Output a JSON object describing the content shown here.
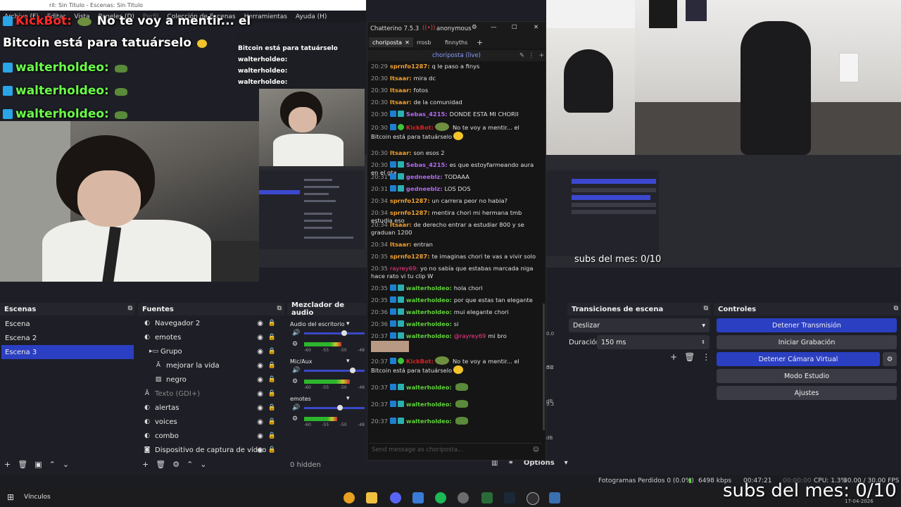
{
  "obs": {
    "window_title": "ril: Sin Titulo - Escenas: Sin Titulo",
    "menu": [
      "Archivo (F)",
      "Editar",
      "Vista",
      "Paneles (D)",
      "Perfil",
      "Colección de Escenas",
      "Herramientas",
      "Ayuda (H)"
    ],
    "scenes": {
      "title": "Escenas",
      "items": [
        "Escena",
        "Escena 2",
        "Escena 3"
      ],
      "selected": 2
    },
    "sources": {
      "title": "Fuentes",
      "items": [
        {
          "label": "Navegador 2",
          "icon": "browser-icon",
          "indent": 0
        },
        {
          "label": "emotes",
          "icon": "browser-icon",
          "indent": 0
        },
        {
          "label": "Grupo",
          "icon": "folder-icon",
          "indent": 1
        },
        {
          "label": "mejorar la vida",
          "icon": "text-icon",
          "indent": 2
        },
        {
          "label": "negro",
          "icon": "image-icon",
          "indent": 2
        },
        {
          "label": "Texto (GDI+)",
          "icon": "text-icon",
          "indent": 0,
          "dim": true
        },
        {
          "label": "alertas",
          "icon": "browser-icon",
          "indent": 0
        },
        {
          "label": "voices",
          "icon": "browser-icon",
          "indent": 0
        },
        {
          "label": "combo",
          "icon": "browser-icon",
          "indent": 0
        },
        {
          "label": "Dispositivo de captura de vídeo",
          "icon": "camera-icon",
          "indent": 0
        }
      ]
    },
    "mixer": {
      "title": "Mezclador de audio",
      "channels": [
        {
          "name": "Audio del escritorio",
          "level": 0.62
        },
        {
          "name": "Mic/Aux",
          "level": 0.75
        },
        {
          "name": "emotes",
          "level": 0.55
        }
      ],
      "ticks": [
        "-60",
        "-55",
        "-50",
        "-48"
      ],
      "right_db": [
        "0.0 dB",
        "5.2 dB",
        "9.3 dB"
      ],
      "hidden": "0 hidden",
      "options": "Options"
    },
    "transitions": {
      "title": "Transiciones de escena",
      "type": "Deslizar",
      "duration_label": "Duración",
      "duration_value": "150 ms"
    },
    "controls": {
      "title": "Controles",
      "buttons": [
        "Detener Transmisión",
        "Iniciar Grabación",
        "Detener Cámara Virtual",
        "Modo Estudio",
        "Ajustes"
      ]
    },
    "status": {
      "dropped": "Fotogramas Perdidos 0 (0.0%)",
      "bitrate": "6498 kbps",
      "live_time": "00:47:21",
      "rec_time": "00:00:00",
      "cpu": "CPU: 1.3%",
      "fps": "30.00 / 30.00 FPS"
    }
  },
  "overlay": {
    "lines": [
      {
        "user": "KickBot:",
        "text": "No te voy a mentir... el"
      },
      {
        "text": "Bitcoin está para tatuárselo"
      },
      {
        "user": "walterholdeo:"
      },
      {
        "user": "walterholdeo:"
      },
      {
        "user": "walterholdeo:"
      }
    ],
    "mini_lines": [
      "Bitcoin está para tatuárselo",
      "walterholdeo:",
      "walterholdeo:",
      "walterholdeo:"
    ],
    "subs_small": "subs del mes: 0/10",
    "subs_big": "subs del mes: 0/10"
  },
  "chatterino": {
    "title": "Chatterino 7.5.3",
    "account": "anonymous",
    "tabs": [
      "choriposta",
      "rrosb",
      "finnyths"
    ],
    "active_tab": 0,
    "channel": "choriposta (live)",
    "input_placeholder": "Send message as choriposta...",
    "messages": [
      {
        "time": "20:29",
        "user": "sprnfo1287:",
        "color": "orange",
        "text": "q le paso a finys"
      },
      {
        "time": "20:30",
        "user": "Itsaar:",
        "color": "orange",
        "text": "mira dc"
      },
      {
        "time": "20:30",
        "user": "Itsaar:",
        "color": "orange",
        "text": "fotos"
      },
      {
        "time": "20:30",
        "user": "Itsaar:",
        "color": "orange",
        "text": "de la comunidad"
      },
      {
        "time": "20:30",
        "user": "Sebas_4215:",
        "color": "purple",
        "text": "DONDE ESTA MI CHORII"
      },
      {
        "time": "20:30",
        "user": "KickBot:",
        "color": "red",
        "text": "No te voy a mentir... el Bitcoin está para tatuárselo"
      },
      {
        "time": "20:30",
        "user": "Itsaar:",
        "color": "orange",
        "text": "son esos 2"
      },
      {
        "time": "20:30",
        "user": "Sebas_4215:",
        "color": "purple",
        "text": "es que estoyfarmeando aura en el gta"
      },
      {
        "time": "20:31",
        "user": "gedneeblz:",
        "color": "purple",
        "text": "TODAAA"
      },
      {
        "time": "20:31",
        "user": "gedneeblz:",
        "color": "purple",
        "text": "LOS DOS"
      },
      {
        "time": "20:34",
        "user": "sprnfo1287:",
        "color": "orange",
        "text": "un carrera peor no habia?"
      },
      {
        "time": "20:34",
        "user": "sprnfo1287:",
        "color": "orange",
        "text": "mentira chori mi hermana tmb estudia eso"
      },
      {
        "time": "20:34",
        "user": "Itsaar:",
        "color": "orange",
        "text": "de derecho entrar a estudiar 800 y se graduan 1200"
      },
      {
        "time": "20:34",
        "user": "Itsaar:",
        "color": "orange",
        "text": "entran"
      },
      {
        "time": "20:35",
        "user": "sprnfo1287:",
        "color": "orange",
        "text": "te imaginas chori te vas a vivir solo"
      },
      {
        "time": "20:35",
        "user": "rayrey69:",
        "color": "pink",
        "text": "yo no sabía que estabas marcada niga hace rato vi tu clip W"
      },
      {
        "time": "20:35",
        "user": "walterholdeo:",
        "color": "green",
        "text": "hola chori"
      },
      {
        "time": "20:35",
        "user": "walterholdeo:",
        "color": "green",
        "text": "por que estas tan elegante"
      },
      {
        "time": "20:36",
        "user": "walterholdeo:",
        "color": "green",
        "text": "mui elegante chori"
      },
      {
        "time": "20:36",
        "user": "walterholdeo:",
        "color": "green",
        "text": "si"
      },
      {
        "time": "20:37",
        "user": "walterholdeo:",
        "color": "green",
        "text": "mi bro",
        "mention": "@rayrey69"
      },
      {
        "time": "20:37",
        "user": "KickBot:",
        "color": "red",
        "text": "No te voy a mentir... el Bitcoin está para tatuárselo"
      },
      {
        "time": "20:37",
        "user": "walterholdeo:",
        "color": "green",
        "text": ""
      },
      {
        "time": "20:37",
        "user": "walterholdeo:",
        "color": "green",
        "text": ""
      },
      {
        "time": "20:37",
        "user": "walterholdeo:",
        "color": "green",
        "text": ""
      }
    ]
  },
  "taskbar": {
    "start_label": "Vínculos",
    "date": "17-04-2026"
  },
  "colors": {
    "accent": "#2b3fc2",
    "panel": "#1e1f26",
    "chat_bg": "#151515"
  }
}
